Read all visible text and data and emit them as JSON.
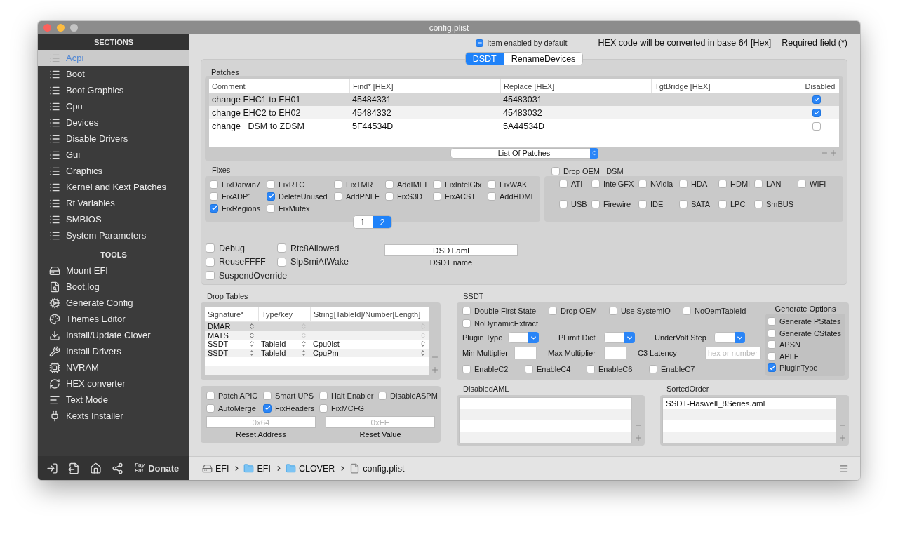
{
  "window": {
    "title": "config.plist"
  },
  "sidebar": {
    "sections_title": "SECTIONS",
    "sections": [
      {
        "label": "Acpi",
        "selected": true
      },
      {
        "label": "Boot",
        "selected": false
      },
      {
        "label": "Boot Graphics",
        "selected": false
      },
      {
        "label": "Cpu",
        "selected": false
      },
      {
        "label": "Devices",
        "selected": false
      },
      {
        "label": "Disable Drivers",
        "selected": false
      },
      {
        "label": "Gui",
        "selected": false
      },
      {
        "label": "Graphics",
        "selected": false
      },
      {
        "label": "Kernel and Kext Patches",
        "selected": false
      },
      {
        "label": "Rt Variables",
        "selected": false
      },
      {
        "label": "SMBIOS",
        "selected": false
      },
      {
        "label": "System Parameters",
        "selected": false
      }
    ],
    "tools_title": "TOOLS",
    "tools": [
      "Mount EFI",
      "Boot.log",
      "Generate Config",
      "Themes Editor",
      "Install/Update Clover",
      "Install Drivers",
      "NVRAM",
      "HEX converter",
      "Text Mode",
      "Kexts Installer"
    ],
    "paypal": [
      "Pay",
      "Pal"
    ],
    "donate": "Donate"
  },
  "header": {
    "item_enabled": {
      "label": "Item enabled by default",
      "checked": true
    },
    "hex_note": "HEX code will be converted in base 64 [Hex]",
    "required_note": "Required field (*)"
  },
  "tabs": [
    {
      "label": "DSDT",
      "selected": true
    },
    {
      "label": "RenameDevices",
      "selected": false
    }
  ],
  "patches": {
    "title": "Patches",
    "columns": [
      "Comment",
      "Find* [HEX]",
      "Replace [HEX]",
      "TgtBridge [HEX]",
      "Disabled"
    ],
    "rows": [
      {
        "comment": "change EHC1 to EH01",
        "find": "45484331",
        "replace": "45483031",
        "disabled": true,
        "selected": true
      },
      {
        "comment": "change EHC2 to EH02",
        "find": "45484332",
        "replace": "45483032",
        "disabled": true,
        "selected": false
      },
      {
        "comment": "change _DSM to ZDSM",
        "find": "5F44534D",
        "replace": "5A44534D",
        "disabled": false,
        "selected": false
      }
    ],
    "popup": "List Of Patches"
  },
  "fixes": {
    "title": "Fixes",
    "items": [
      {
        "label": "FixDarwin7",
        "checked": false
      },
      {
        "label": "FixRTC",
        "checked": false
      },
      {
        "label": "FixTMR",
        "checked": false
      },
      {
        "label": "AddIMEI",
        "checked": false
      },
      {
        "label": "FixIntelGfx",
        "checked": false
      },
      {
        "label": "FixWAK",
        "checked": false
      },
      {
        "label": "FixADP1",
        "checked": false
      },
      {
        "label": "DeleteUnused",
        "checked": true
      },
      {
        "label": "AddPNLF",
        "checked": false
      },
      {
        "label": "FixS3D",
        "checked": false
      },
      {
        "label": "FixACST",
        "checked": false
      },
      {
        "label": "AddHDMI",
        "checked": false
      },
      {
        "label": "FixRegions",
        "checked": true
      },
      {
        "label": "FixMutex",
        "checked": false
      }
    ],
    "pages": [
      {
        "label": "1",
        "selected": false
      },
      {
        "label": "2",
        "selected": true
      }
    ]
  },
  "drop_oem_dsm": {
    "label": "Drop OEM _DSM",
    "checked": false,
    "items": [
      {
        "label": "ATI",
        "checked": false
      },
      {
        "label": "IntelGFX",
        "checked": false
      },
      {
        "label": "NVidia",
        "checked": false
      },
      {
        "label": "HDA",
        "checked": false
      },
      {
        "label": "HDMI",
        "checked": false
      },
      {
        "label": "LAN",
        "checked": false
      },
      {
        "label": "WIFI",
        "checked": false
      },
      {
        "label": "USB",
        "checked": false
      },
      {
        "label": "Firewire",
        "checked": false
      },
      {
        "label": "IDE",
        "checked": false
      },
      {
        "label": "SATA",
        "checked": false
      },
      {
        "label": "LPC",
        "checked": false
      },
      {
        "label": "SmBUS",
        "checked": false
      }
    ]
  },
  "options": [
    {
      "label": "Debug",
      "checked": false
    },
    {
      "label": "Rtc8Allowed",
      "checked": false
    },
    {
      "label": "ReuseFFFF",
      "checked": false
    },
    {
      "label": "SlpSmiAtWake",
      "checked": false
    },
    {
      "label": "SuspendOverride",
      "checked": false
    }
  ],
  "dsdt_name": {
    "value": "DSDT.aml",
    "label": "DSDT name"
  },
  "drop_tables": {
    "title": "Drop Tables",
    "columns": [
      "Signature*",
      "Type/key",
      "String[TableId]/Number[Length]"
    ],
    "rows": [
      {
        "signature": "DMAR",
        "selected": true
      },
      {
        "signature": "MATS",
        "selected": false
      },
      {
        "signature": "SSDT",
        "type": "TableId",
        "string": "Cpu0Ist",
        "selected": false
      },
      {
        "signature": "SSDT",
        "type": "TableId",
        "string": "CpuPm",
        "selected": false
      }
    ]
  },
  "acpi_flags": [
    {
      "label": "Patch APIC",
      "checked": false
    },
    {
      "label": "Smart UPS",
      "checked": false
    },
    {
      "label": "Halt Enabler",
      "checked": false
    },
    {
      "label": "DisableASPM",
      "checked": false
    },
    {
      "label": "AutoMerge",
      "checked": false
    },
    {
      "label": "FixHeaders",
      "checked": true
    },
    {
      "label": "FixMCFG",
      "checked": false
    }
  ],
  "reset_address": {
    "placeholder": "0x64",
    "label": "Reset Address"
  },
  "reset_value": {
    "placeholder": "0xFE",
    "label": "Reset Value"
  },
  "ssdt": {
    "title": "SSDT",
    "checks": [
      {
        "label": "Double First State",
        "checked": false
      },
      {
        "label": "Drop OEM",
        "checked": false
      },
      {
        "label": "Use SystemIO",
        "checked": false
      },
      {
        "label": "NoOemTableId",
        "checked": false
      },
      {
        "label": "NoDynamicExtract",
        "checked": false
      }
    ],
    "selects": [
      {
        "label": "Plugin Type"
      },
      {
        "label": "PLimit Dict"
      },
      {
        "label": "UnderVolt Step"
      }
    ],
    "fields": [
      {
        "label": "Min Multiplier"
      },
      {
        "label": "Max Multiplier"
      },
      {
        "label": "C3 Latency",
        "placeholder": "hex or number"
      }
    ],
    "cstates": [
      {
        "label": "EnableC2",
        "checked": false
      },
      {
        "label": "EnableC4",
        "checked": false
      },
      {
        "label": "EnableC6",
        "checked": false
      },
      {
        "label": "EnableC7",
        "checked": false
      }
    ],
    "generate": {
      "title": "Generate Options",
      "items": [
        {
          "label": "Generate PStates",
          "checked": false
        },
        {
          "label": "Generate CStates",
          "checked": false
        },
        {
          "label": "APSN",
          "checked": false
        },
        {
          "label": "APLF",
          "checked": false
        },
        {
          "label": "PluginType",
          "checked": true
        }
      ]
    }
  },
  "disabled_aml": {
    "title": "DisabledAML"
  },
  "sorted_order": {
    "title": "SortedOrder",
    "items": [
      "SSDT-Haswell_8Series.aml"
    ]
  },
  "path_bar": [
    {
      "label": "EFI",
      "kind": "disk"
    },
    {
      "label": "EFI",
      "kind": "folder"
    },
    {
      "label": "CLOVER",
      "kind": "folder"
    },
    {
      "label": "config.plist",
      "kind": "file"
    }
  ]
}
